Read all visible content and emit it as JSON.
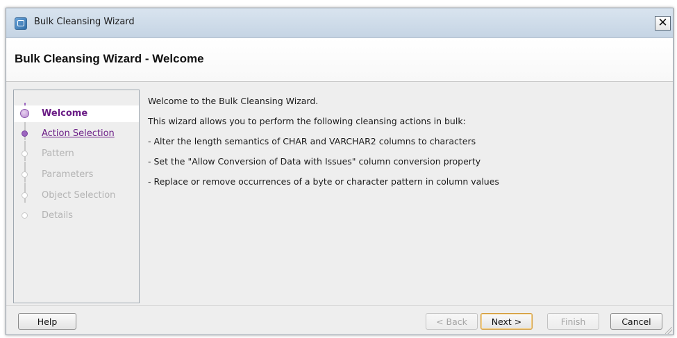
{
  "window": {
    "title": "Bulk Cleansing Wizard",
    "close_label": "✕"
  },
  "header": {
    "title": "Bulk Cleansing Wizard - Welcome"
  },
  "steps": [
    {
      "label": "Welcome",
      "state": "current"
    },
    {
      "label": "Action Selection",
      "state": "visited"
    },
    {
      "label": "Pattern",
      "state": "disabled"
    },
    {
      "label": "Parameters",
      "state": "disabled"
    },
    {
      "label": "Object Selection",
      "state": "disabled"
    },
    {
      "label": "Details",
      "state": "disabled"
    }
  ],
  "content": {
    "lines": [
      "Welcome to the Bulk Cleansing Wizard.",
      "This wizard allows you to perform the following cleansing actions in bulk:",
      "- Alter the length semantics of CHAR and VARCHAR2 columns to characters",
      "- Set the \"Allow Conversion of Data with Issues\" column conversion property",
      "- Replace or remove occurrences of a byte or character pattern in column values"
    ]
  },
  "buttons": {
    "help": "Help",
    "back": "< Back",
    "next": "Next >",
    "finish": "Finish",
    "cancel": "Cancel"
  },
  "colors": {
    "visited_step": "#6b1d86",
    "disabled_step": "#b4b4b4",
    "titlebar": "#c5d4e4"
  }
}
